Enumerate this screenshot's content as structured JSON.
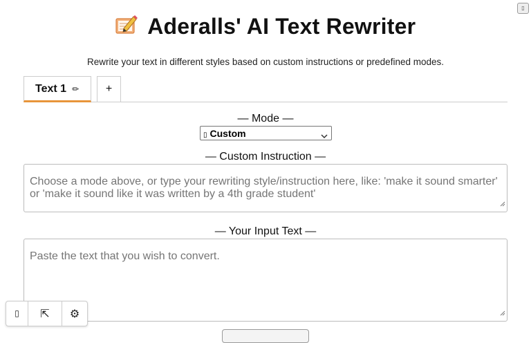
{
  "corner": {
    "icon": "expand-icon",
    "glyph": "▯"
  },
  "header": {
    "logo_icon": "memo-pencil-icon",
    "title": "Aderalls' AI Text Rewriter"
  },
  "subtitle": "Rewrite your text in different styles based on custom instructions or predefined modes.",
  "tabs": {
    "active_label": "Text 1",
    "active_edit_glyph": "✏",
    "add_label": "+"
  },
  "mode": {
    "label": "— Mode —",
    "selected_icon_glyph": "▯",
    "selected_value": "Custom",
    "caret_glyph": "⌄"
  },
  "custom_instruction": {
    "label": "— Custom Instruction —",
    "placeholder": "Choose a mode above, or type your rewriting style/instruction here, like: 'make it sound smarter' or 'make it sound like it was written by a 4th grade student'"
  },
  "input_text": {
    "label": "— Your Input Text —",
    "placeholder": "Paste the text that you wish to convert."
  },
  "toolbar": {
    "btn1_glyph": "▯",
    "btn2_glyph": "⇱",
    "btn3_glyph": "⚙"
  },
  "colors": {
    "tab_active_underline": "#e8953a",
    "border": "#cccccc"
  }
}
